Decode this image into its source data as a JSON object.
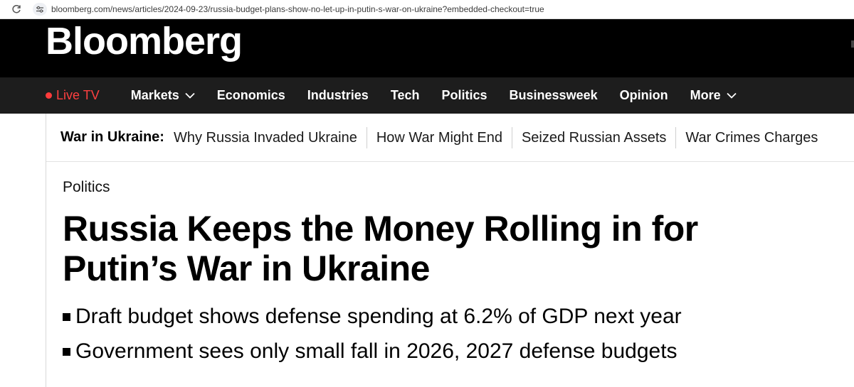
{
  "browser": {
    "url": "bloomberg.com/news/articles/2024-09-23/russia-budget-plans-show-no-let-up-in-putin-s-war-on-ukraine?embedded-checkout=true",
    "icons": [
      "reload-icon",
      "site-info-icon"
    ]
  },
  "masthead": {
    "logo": "Bloomberg"
  },
  "nav": {
    "live_tv": "Live TV",
    "items": [
      {
        "label": "Markets",
        "has_dropdown": true
      },
      {
        "label": "Economics",
        "has_dropdown": false
      },
      {
        "label": "Industries",
        "has_dropdown": false
      },
      {
        "label": "Tech",
        "has_dropdown": false
      },
      {
        "label": "Politics",
        "has_dropdown": false
      },
      {
        "label": "Businessweek",
        "has_dropdown": false
      },
      {
        "label": "Opinion",
        "has_dropdown": false
      },
      {
        "label": "More",
        "has_dropdown": true
      }
    ],
    "colors": {
      "background": "#1d1d1d",
      "live": "#ff4040"
    }
  },
  "topic_bar": {
    "label": "War in Ukraine:",
    "links": [
      "Why Russia Invaded Ukraine",
      "How War Might End",
      "Seized Russian Assets",
      "War Crimes Charges"
    ]
  },
  "article": {
    "kicker": "Politics",
    "headline": "Russia Keeps the Money Rolling in for Putin’s War in Ukraine",
    "bullets": [
      "Draft budget shows defense spending at 6.2% of GDP next year",
      "Government sees only small fall in 2026, 2027 defense budgets"
    ]
  }
}
